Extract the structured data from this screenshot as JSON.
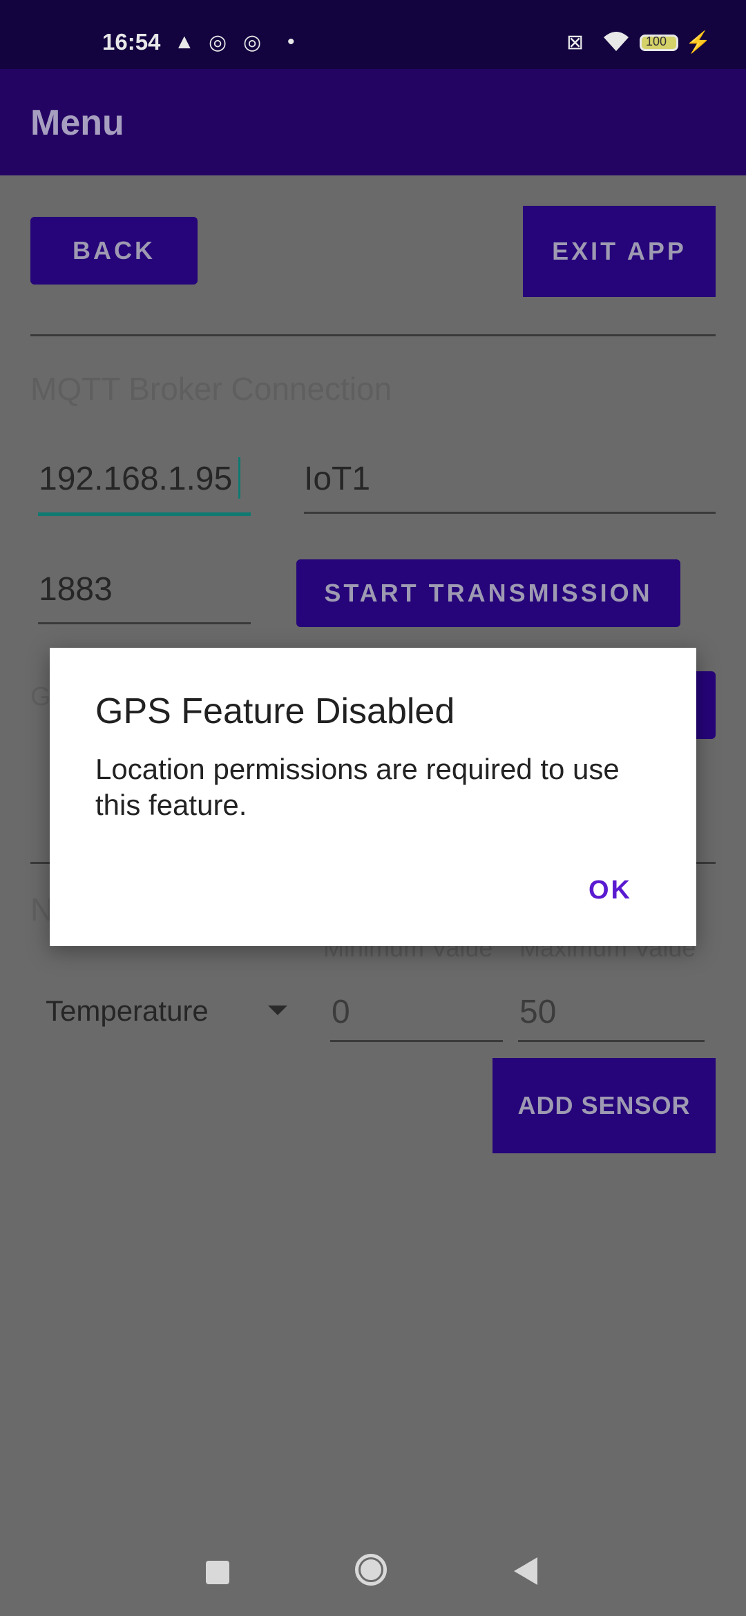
{
  "status_bar": {
    "time": "16:54",
    "battery": "100",
    "icons": [
      "alert-icon",
      "at-icon",
      "at-icon",
      "dot-icon",
      "sim-icon",
      "wifi-icon",
      "battery-icon",
      "charging-icon"
    ]
  },
  "app_bar": {
    "title": "Menu"
  },
  "buttons": {
    "back": "BACK",
    "exit": "EXIT APP",
    "start": "START TRANSMISSION",
    "add_sensor": "ADD SENSOR"
  },
  "mqtt": {
    "section_title": "MQTT Broker Connection",
    "ip_value": "192.168.1.95",
    "topic_value": "IoT1",
    "port_value": "1883"
  },
  "partial_labels": {
    "g_letter": "G",
    "n_letter": "N"
  },
  "sensor": {
    "min_label": "Minimum Value",
    "max_label": "Maximum Value",
    "type_selected": "Temperature",
    "min_value": "0",
    "max_value": "50"
  },
  "dialog": {
    "title": "GPS Feature Disabled",
    "message": "Location permissions are required to use this feature.",
    "ok": "OK"
  },
  "colors": {
    "accent": "#26047a",
    "dialog_button": "#5a1ad0",
    "input_focus": "#0f7a72"
  }
}
